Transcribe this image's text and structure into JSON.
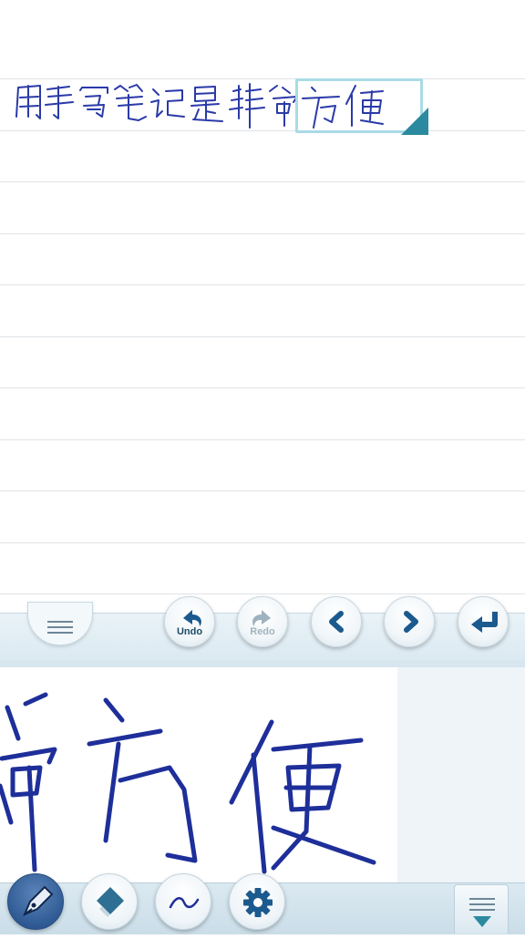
{
  "toolbar": {
    "undo_label": "Undo",
    "redo_label": "Redo",
    "undo_icon": "undo-arrow-icon",
    "redo_icon": "redo-arrow-icon",
    "prev_icon": "chevron-left-icon",
    "next_icon": "chevron-right-icon",
    "enter_icon": "enter-return-icon",
    "menu_icon": "menu-lines-icon",
    "redo_state": "disabled"
  },
  "tools": {
    "pen_icon": "pen-nib-icon",
    "eraser_icon": "eraser-icon",
    "stroke_icon": "stroke-wave-icon",
    "settings_icon": "gear-icon",
    "collapse_icon": "collapse-down-icon",
    "active_tool": "pen"
  },
  "colors": {
    "ink": "#1e2f9a",
    "accent": "#1b5a8e",
    "selection": "#a9dbe6",
    "handle": "#2b8aa0",
    "toolbar_bg": "#dbe9f1"
  }
}
